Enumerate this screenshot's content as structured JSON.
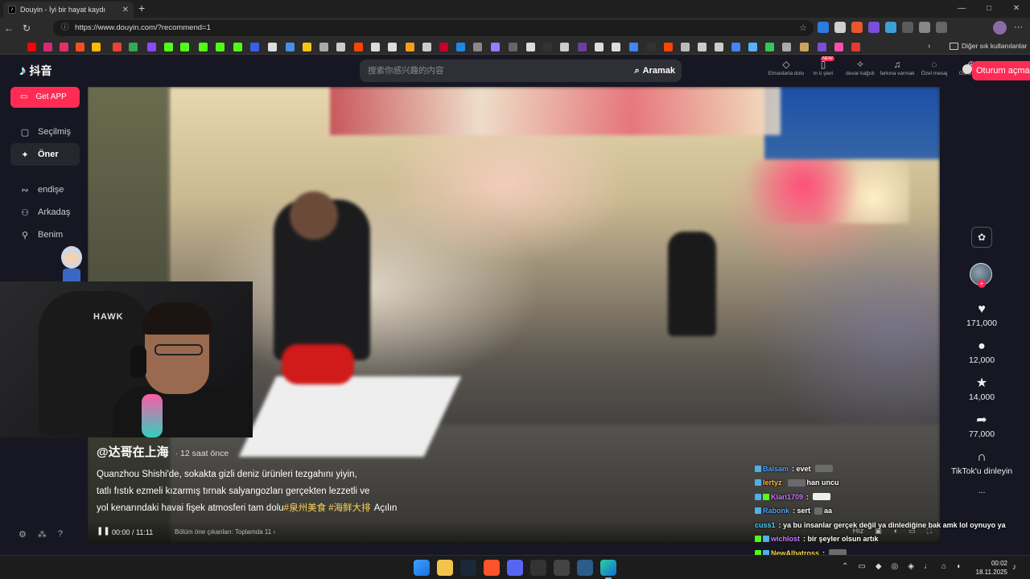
{
  "browser": {
    "tab_title": "Douyin - İyi bir hayat kaydı",
    "tab_favicon": "♪",
    "url": "https://www.douyin.com/?recommend=1",
    "bookmarks_folder": "Diğer sık kullanılanlar",
    "window_controls": [
      "—",
      "□",
      "✕"
    ]
  },
  "site": {
    "logo_text": "抖音",
    "search_placeholder": "搜索你感兴趣的内容",
    "search_button": "Aramak",
    "header_items": [
      {
        "icon": "diamond-icon",
        "label": "Elmaslarla dolu"
      },
      {
        "icon": "phone-icon",
        "label": "m ü şteri",
        "badge": "NEW"
      },
      {
        "icon": "wallpaper-icon",
        "label": "duvar kağıdı"
      },
      {
        "icon": "bell-icon",
        "label": "farkına varmak"
      },
      {
        "icon": "message-icon",
        "label": "Özel mesaj"
      },
      {
        "icon": "upload-icon",
        "label": "Gönderme"
      }
    ],
    "login_button": "Oturum açma",
    "get_app": "Get APP",
    "nav": [
      {
        "label": "Seçilmiş",
        "icon": "featured-icon"
      },
      {
        "label": "Öner",
        "icon": "sparkle-icon",
        "active": true
      },
      {
        "label": "endişe",
        "icon": "follow-icon"
      },
      {
        "label": "Arkadaş",
        "icon": "friends-icon"
      },
      {
        "label": "Benim",
        "icon": "profile-icon"
      }
    ]
  },
  "video": {
    "author": "@达哥在上海",
    "posted": "· 12 saat önce",
    "description_lines": [
      "Quanzhou Shishi'de, sokakta gizli deniz ürünleri tezgahını yiyin,",
      "tatlı fıstık ezmeli kızarmış tırnak salyangozları gerçekten lezzetli ve",
      "yol kenarındaki havai fişek atmosferi tam dolu"
    ],
    "hashtags": [
      "#泉州美食",
      "#海鲜大排"
    ],
    "expand": "Açılın",
    "time_current": "00:00",
    "time_total": "11:11",
    "chapters_label": "Bölüm öne çıkanları: Toplamda 11 ›",
    "quality": "Hız",
    "likes": "171,000",
    "comments": "12,000",
    "favorites": "14,000",
    "shares": "77,000",
    "listen_label": "TikTok'u dinleyin",
    "more": "..."
  },
  "stream_overlay": {
    "cam_brand": "HAWK",
    "chat": [
      {
        "user": "Balsam",
        "msg": ": evet",
        "user_color": "#4fa8ff",
        "emote": true
      },
      {
        "user": "lertyz",
        "msg": "han uncu",
        "user_color": "#ffb84a",
        "emote": true
      },
      {
        "user": "Klari1709",
        "msg": "",
        "user_color": "#c77bff",
        "emote": true,
        "kick": true
      },
      {
        "user": "Rabonk",
        "msg": ": sert",
        "user_color": "#4fa8ff",
        "emote": true,
        "msg_after": "aa"
      },
      {
        "user": "cuss1",
        "msg": ": ya bu insanlar gerçek değil ya dinlediğine bak amk lol oynuyo ya",
        "user_color": "#4fd2ff"
      },
      {
        "user": "wichlost",
        "msg": ": bir şeyler olsun artık",
        "user_color": "#c77bff",
        "kick": true
      },
      {
        "user": "NewAlbatross",
        "msg": ":",
        "user_color": "#ffd84a",
        "emote": true,
        "kick": true
      }
    ]
  },
  "taskbar": {
    "time": "00:02",
    "date": "18.11.2025"
  }
}
